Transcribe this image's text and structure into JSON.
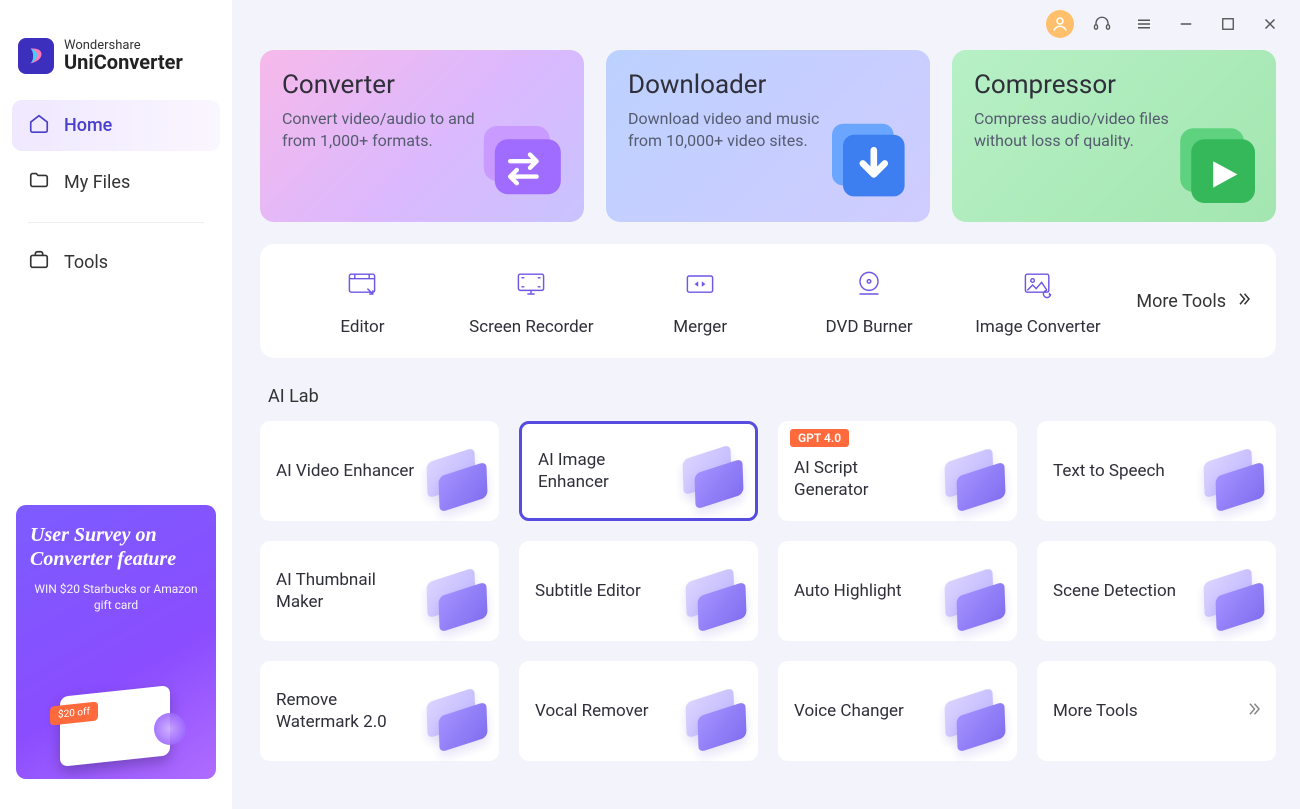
{
  "brand": {
    "top": "Wondershare",
    "bottom": "UniConverter"
  },
  "sidebar": {
    "items": [
      {
        "label": "Home",
        "icon": "home-icon",
        "active": true
      },
      {
        "label": "My Files",
        "icon": "folder-icon",
        "active": false
      },
      {
        "label": "Tools",
        "icon": "briefcase-icon",
        "active": false
      }
    ]
  },
  "promo": {
    "title": "User Survey on Converter feature",
    "subtitle": "WIN $20 Starbucks or Amazon gift card",
    "tag": "$20 off"
  },
  "hero": [
    {
      "title": "Converter",
      "desc": "Convert video/audio to and from 1,000+ formats."
    },
    {
      "title": "Downloader",
      "desc": "Download video and music from 10,000+ video sites."
    },
    {
      "title": "Compressor",
      "desc": "Compress audio/video files without loss of quality."
    }
  ],
  "toolrow": {
    "items": [
      {
        "label": "Editor"
      },
      {
        "label": "Screen Recorder"
      },
      {
        "label": "Merger"
      },
      {
        "label": "DVD Burner"
      },
      {
        "label": "Image Converter"
      }
    ],
    "more": "More Tools"
  },
  "ailab": {
    "heading": "AI Lab",
    "cells": [
      {
        "label": "AI Video Enhancer"
      },
      {
        "label": "AI Image Enhancer",
        "selected": true
      },
      {
        "label": "AI Script Generator",
        "badge": "GPT 4.0"
      },
      {
        "label": "Text to Speech"
      },
      {
        "label": "AI Thumbnail Maker"
      },
      {
        "label": "Subtitle Editor"
      },
      {
        "label": "Auto Highlight"
      },
      {
        "label": "Scene Detection"
      },
      {
        "label": "Remove Watermark 2.0"
      },
      {
        "label": "Vocal Remover"
      },
      {
        "label": "Voice Changer"
      },
      {
        "label": "More Tools",
        "more": true
      }
    ]
  }
}
